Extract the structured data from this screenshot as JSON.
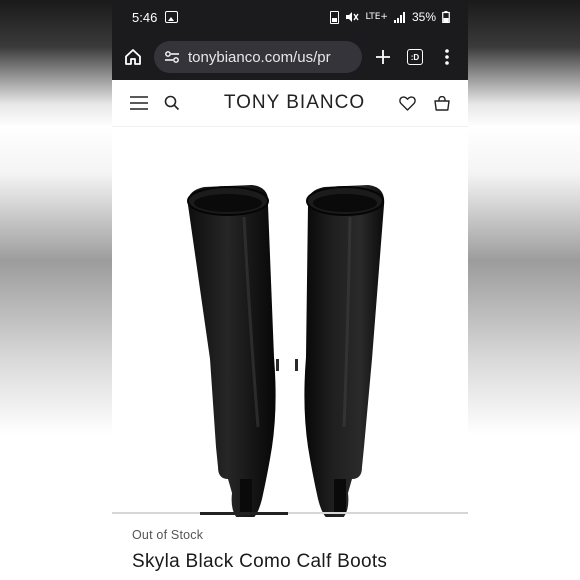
{
  "status_bar": {
    "time": "5:46",
    "network": "LTE+",
    "battery_percent": "35%"
  },
  "browser": {
    "url": "tonybianco.com/us/pr",
    "tab_count": ":D"
  },
  "site": {
    "brand": "TONY BIANCO"
  },
  "product": {
    "stock_status": "Out of Stock",
    "title": "Skyla Black Como Calf Boots",
    "image_carousel": {
      "active_index": 1,
      "total": 4
    }
  },
  "colors": {
    "browser_chrome": "#1b1b1d",
    "url_pill": "#34343a",
    "text_dark": "#1a1a1a"
  }
}
